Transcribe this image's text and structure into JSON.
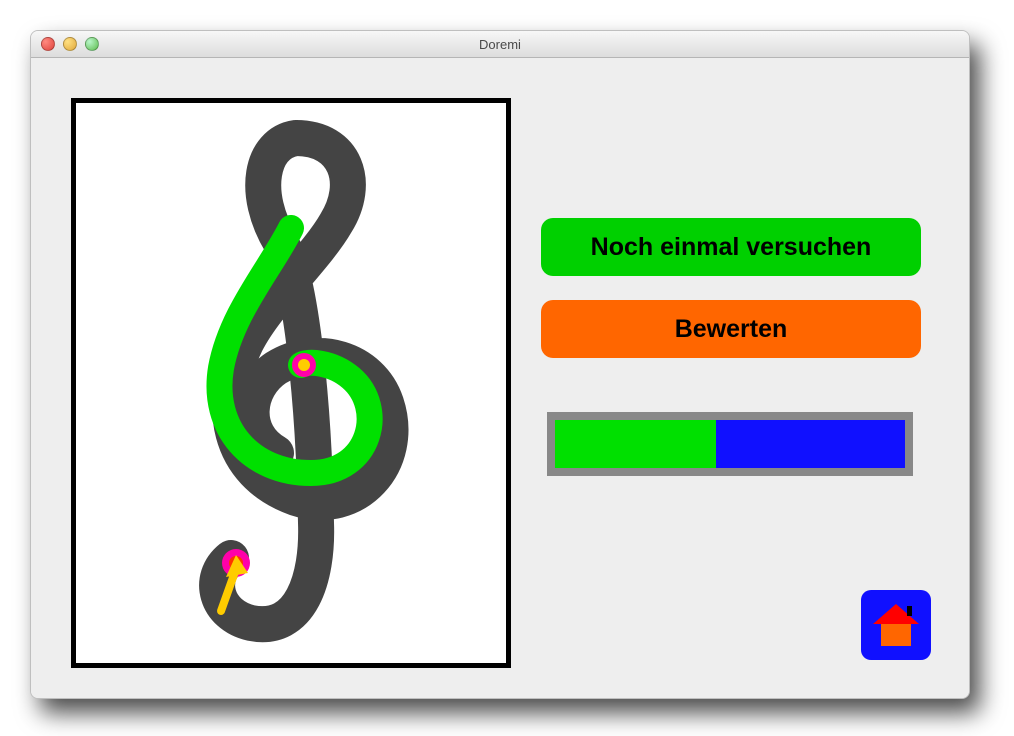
{
  "window": {
    "title": "Doremi"
  },
  "buttons": {
    "retry": "Noch einmal versuchen",
    "evaluate": "Bewerten"
  },
  "progress": {
    "green_percent": 46,
    "blue_percent": 54
  },
  "colors": {
    "accent_green": "#00d000",
    "accent_orange": "#ff6600",
    "progress_green": "#00e000",
    "progress_blue": "#1010ff",
    "canvas_stroke": "#444444",
    "user_stroke": "#00e000"
  },
  "icons": {
    "home": "home-icon"
  }
}
